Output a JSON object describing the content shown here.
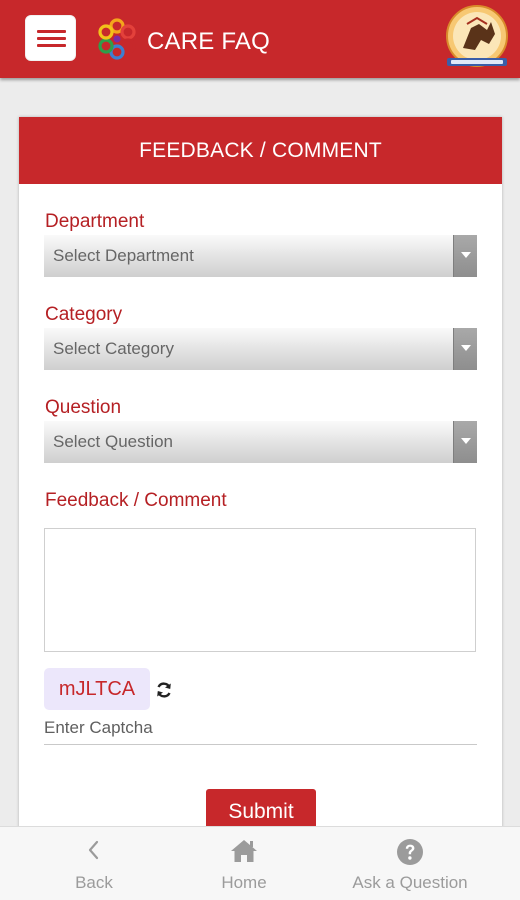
{
  "header": {
    "title": "CARE FAQ",
    "menu_icon": "hamburger-menu-icon",
    "logo_icon": "care-flower-logo-icon",
    "emblem_icon": "government-emblem-logo"
  },
  "form": {
    "title": "FEEDBACK / COMMENT",
    "department": {
      "label": "Department",
      "selected": "Select Department"
    },
    "category": {
      "label": "Category",
      "selected": "Select Category"
    },
    "question": {
      "label": "Question",
      "selected": "Select Question"
    },
    "feedback": {
      "label": "Feedback / Comment",
      "value": ""
    },
    "captcha": {
      "code": "mJLTCA",
      "placeholder": "Enter Captcha",
      "refresh_icon": "refresh-icon"
    },
    "submit_label": "Submit"
  },
  "bottom_nav": {
    "items": [
      {
        "label": "Back",
        "icon": "chevron-left-icon"
      },
      {
        "label": "Home",
        "icon": "home-icon"
      },
      {
        "label": "Ask a Question",
        "icon": "question-circle-icon"
      }
    ]
  },
  "colors": {
    "primary": "#c7282b",
    "label": "#b52024",
    "captcha_bg": "#ece7fb",
    "nav_text": "#9b9b9b"
  }
}
